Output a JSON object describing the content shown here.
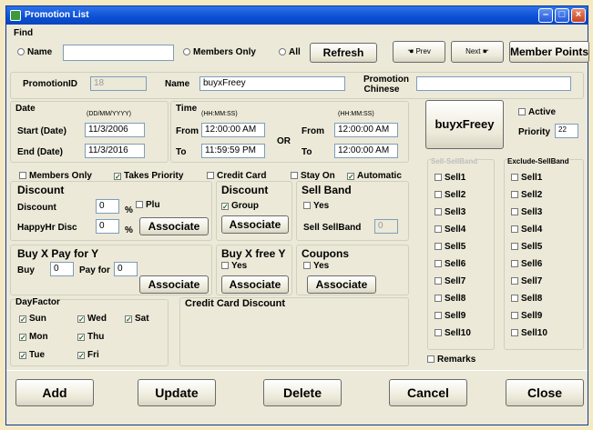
{
  "window": {
    "title": "Promotion List"
  },
  "find": {
    "label": "Find",
    "name_label": "Name",
    "members_only_label": "Members Only",
    "all_label": "All",
    "refresh_label": "Refresh",
    "prev_label": "Prev",
    "next_label": "Next",
    "member_points_label": "Member Points"
  },
  "promo": {
    "id_label": "PromotionID",
    "id_value": "18",
    "name_label": "Name",
    "name_value": "buyxFreey",
    "chinese_label_1": "Promotion",
    "chinese_label_2": "Chinese",
    "chinese_value": ""
  },
  "date": {
    "label": "Date",
    "format": "(DD/MM/YYYY)",
    "start_label": "Start (Date)",
    "start_value": "11/3/2006",
    "end_label": "End (Date)",
    "end_value": "11/3/2016"
  },
  "time": {
    "label": "Time",
    "format1": "(HH:MM:SS)",
    "format2": "(HH:MM:SS)",
    "from_label": "From",
    "to_label": "To",
    "or_label": "OR",
    "from1": "12:00:00 AM",
    "to1": "11:59:59 PM",
    "from2": "12:00:00 AM",
    "to2": "12:00:00 AM"
  },
  "badge_button": "buyxFreey",
  "active_label": "Active",
  "priority_label": "Priority",
  "priority_value": "22",
  "flags": {
    "members_only": "Members Only",
    "takes_priority": "Takes Priority",
    "credit_card": "Credit Card",
    "stay_on": "Stay On",
    "automatic": "Automatic"
  },
  "discount": {
    "label": "Discount",
    "discount_label": "Discount",
    "discount_value": "0",
    "percent": "%",
    "plu_label": "Plu",
    "happyhr_label": "HappyHr Disc",
    "happyhr_value": "0",
    "percent2": "%",
    "associate_label": "Associate"
  },
  "discount2": {
    "label": "Discount",
    "group_label": "Group",
    "associate_label": "Associate"
  },
  "sellband": {
    "label": "Sell Band",
    "yes_label": "Yes",
    "sellband_label": "Sell SellBand",
    "sellband_value": "0"
  },
  "buyxpayy": {
    "label": "Buy X Pay for Y",
    "buy_label": "Buy",
    "buy_value": "0",
    "payfor_label": "Pay for",
    "payfor_value": "0",
    "associate_label": "Associate"
  },
  "buyxfreey": {
    "label": "Buy X free Y",
    "yes_label": "Yes",
    "associate_label": "Associate"
  },
  "coupons": {
    "label": "Coupons",
    "yes_label": "Yes",
    "associate_label": "Associate"
  },
  "dayfactor": {
    "label": "DayFactor",
    "days": [
      "Sun",
      "Wed",
      "Sat",
      "Mon",
      "Thu",
      "Tue",
      "Fri"
    ]
  },
  "credit_card_discount_label": "Credit Card Discount",
  "sell_sellband": {
    "label": "Sell-SellBand",
    "items": [
      "Sell1",
      "Sell2",
      "Sell3",
      "Sell4",
      "Sell5",
      "Sell6",
      "Sell7",
      "Sell8",
      "Sell9",
      "Sell10"
    ]
  },
  "exclude_sellband": {
    "label": "Exclude-SellBand",
    "items": [
      "Sell1",
      "Sell2",
      "Sell3",
      "Sell4",
      "Sell5",
      "Sell6",
      "Sell7",
      "Sell8",
      "Sell9",
      "Sell10"
    ]
  },
  "remarks_label": "Remarks",
  "actions": {
    "add": "Add",
    "update": "Update",
    "delete": "Delete",
    "cancel": "Cancel",
    "close": "Close"
  }
}
